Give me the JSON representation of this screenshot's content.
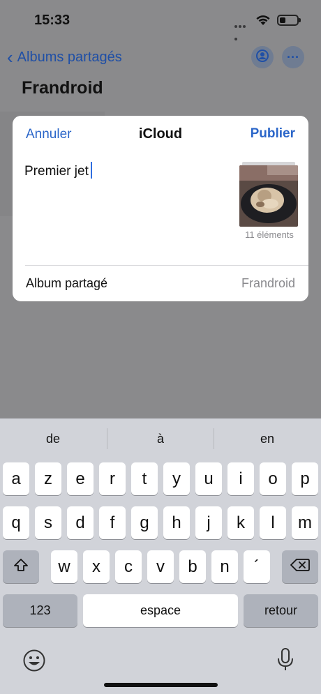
{
  "status_bar": {
    "time": "15:33"
  },
  "nav": {
    "back_label": "Albums partagés",
    "more_label": "···"
  },
  "page": {
    "title": "Frandroid"
  },
  "share_sheet": {
    "cancel_label": "Annuler",
    "title": "iCloud",
    "publish_label": "Publier",
    "comment_text": "Premier jet",
    "items_count_label": "11 éléments",
    "album_label": "Album partagé",
    "album_value": "Frandroid"
  },
  "keyboard": {
    "suggestions": [
      "de",
      "à",
      "en"
    ],
    "row1": [
      "a",
      "z",
      "e",
      "r",
      "t",
      "y",
      "u",
      "i",
      "o",
      "p"
    ],
    "row2": [
      "q",
      "s",
      "d",
      "f",
      "g",
      "h",
      "j",
      "k",
      "l",
      "m"
    ],
    "row3": [
      "w",
      "x",
      "c",
      "v",
      "b",
      "n",
      "´"
    ],
    "numbers_key": "123",
    "space_key": "espace",
    "return_key": "retour"
  },
  "colors": {
    "accent": "#2b66c9",
    "keyboard_bg": "#d1d3d9",
    "dim_overlay": "#8a8a8c"
  }
}
